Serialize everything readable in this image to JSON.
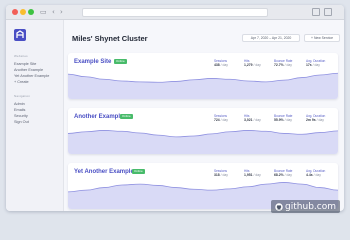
{
  "colors": {
    "accent": "#4a4fc4",
    "badge": "#48bb6a",
    "chart_fill": "#d9daf6",
    "chart_line": "#8e90e0"
  },
  "sidebar": {
    "groups": [
      {
        "heading": "Websites",
        "items": [
          "Example Site",
          "Another Example",
          "Yet Another Example",
          "+ Create"
        ]
      },
      {
        "heading": "Navigation",
        "items": [
          "Admin",
          "Emails",
          "Security",
          "Sign Out"
        ]
      }
    ]
  },
  "header": {
    "title": "Miles' Shynet Cluster",
    "date_range": "Apr 7, 2020 – Apr 21, 2020",
    "new_service": "+ New Service"
  },
  "services": [
    {
      "name": "Example Site",
      "badge": "Online",
      "stats": [
        {
          "label": "Sessions",
          "value": "438",
          "unit": "/ day"
        },
        {
          "label": "Hits",
          "value": "1,279",
          "unit": "/ day"
        },
        {
          "label": "Bounce Rate",
          "value": "72.7%",
          "unit": "/ day"
        },
        {
          "label": "Avg. Duration",
          "value": "17s",
          "unit": "/ day"
        }
      ],
      "chart_points": [
        58,
        52,
        46,
        42,
        40,
        39,
        41,
        45,
        48,
        46,
        42,
        40,
        44,
        50,
        56,
        60
      ]
    },
    {
      "name": "Another Example",
      "badge": "Online",
      "stats": [
        {
          "label": "Sessions",
          "value": "724",
          "unit": "/ day"
        },
        {
          "label": "Hits",
          "value": "3,021",
          "unit": "/ day"
        },
        {
          "label": "Bounce Rate",
          "value": "55.9%",
          "unit": "/ day"
        },
        {
          "label": "Avg. Duration",
          "value": "2m 9s",
          "unit": "/ day"
        }
      ],
      "chart_points": [
        48,
        52,
        55,
        53,
        49,
        44,
        40,
        42,
        47,
        52,
        55,
        53,
        48,
        46,
        50,
        54
      ]
    },
    {
      "name": "Yet Another Example",
      "badge": "Online",
      "stats": [
        {
          "label": "Sessions",
          "value": "318",
          "unit": "/ day"
        },
        {
          "label": "Hits",
          "value": "1,951",
          "unit": "/ day"
        },
        {
          "label": "Bounce Rate",
          "value": "68.2%",
          "unit": "/ day"
        },
        {
          "label": "Avg. Duration",
          "value": "4.4s",
          "unit": "/ day"
        }
      ],
      "chart_points": [
        40,
        44,
        50,
        56,
        58,
        55,
        50,
        46,
        44,
        47,
        52,
        58,
        62,
        58,
        50,
        44
      ]
    }
  ],
  "watermark": {
    "text": "github.com"
  }
}
